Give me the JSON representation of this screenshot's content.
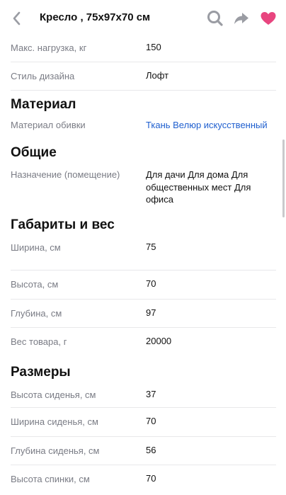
{
  "header": {
    "title": "Кресло , 75х97х70 см",
    "icons": {
      "back": "chevron-left-icon",
      "search": "search-icon",
      "share": "share-arrow-icon",
      "favorite": "heart-icon"
    },
    "colors": {
      "favorite": "#e8457f",
      "icons": "#9a9ca3"
    }
  },
  "specs": {
    "rows_top": [
      {
        "label": "Макс. нагрузка, кг",
        "value": "150"
      },
      {
        "label": "Стиль дизайна",
        "value": "Лофт"
      }
    ],
    "material": {
      "title": "Материал",
      "rows": [
        {
          "label": "Материал обивки",
          "value": "Ткань Велюр искусственный"
        }
      ]
    },
    "general": {
      "title": "Общие",
      "rows": [
        {
          "label": "Назначение (помещение)",
          "value_lines": [
            "Для дачи Для дома Для",
            "общественных мест Для",
            "офиса"
          ]
        }
      ]
    },
    "dimensions": {
      "title": "Габариты и вес",
      "rows": [
        {
          "label": "Ширина, см",
          "value": "75"
        },
        {
          "label": "Высота, см",
          "value": "70"
        },
        {
          "label": "Глубина, см",
          "value": "97"
        },
        {
          "label": "Вес товара, г",
          "value": "20000"
        }
      ]
    },
    "sizes": {
      "title": "Размеры",
      "rows": [
        {
          "label": "Высота сиденья, см",
          "value": "37"
        },
        {
          "label": "Ширина сиденья, см",
          "value": "70"
        },
        {
          "label": "Глубина сиденья, см",
          "value": "56"
        },
        {
          "label": "Высота спинки, см",
          "value": "70"
        }
      ]
    }
  },
  "colors": {
    "link": "#1f5fcf",
    "label": "#7a7c85",
    "divider": "#e8e8ea"
  }
}
